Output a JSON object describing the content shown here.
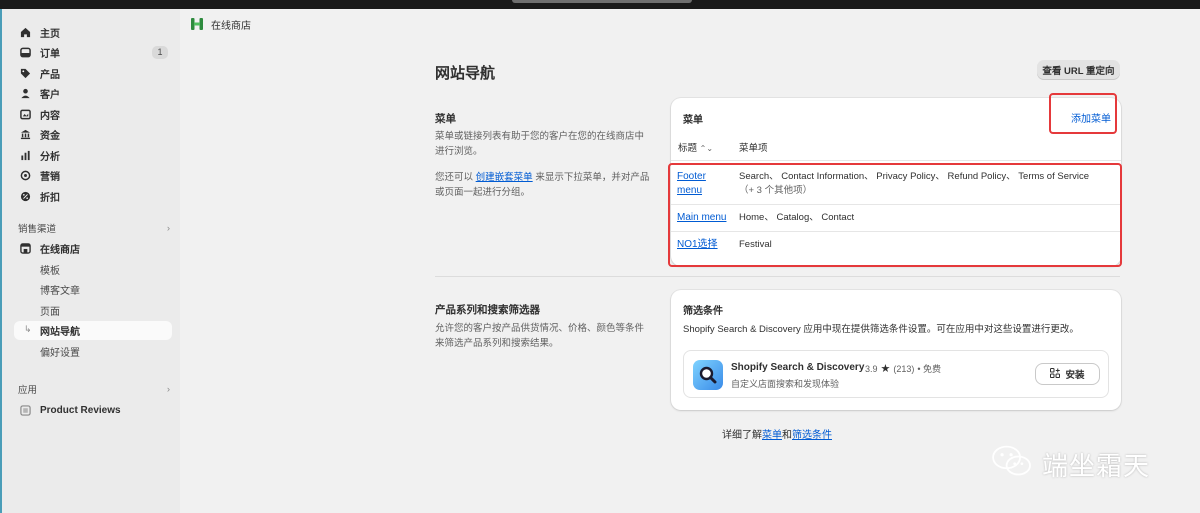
{
  "sidebar": {
    "nav": [
      {
        "label": "主页",
        "icon": "home-icon"
      },
      {
        "label": "订单",
        "icon": "inbox-icon",
        "badge": "1"
      },
      {
        "label": "产品",
        "icon": "tag-icon"
      },
      {
        "label": "客户",
        "icon": "person-icon"
      },
      {
        "label": "内容",
        "icon": "content-icon"
      },
      {
        "label": "资金",
        "icon": "bank-icon"
      },
      {
        "label": "分析",
        "icon": "bar-chart-icon"
      },
      {
        "label": "营销",
        "icon": "target-icon"
      },
      {
        "label": "折扣",
        "icon": "discount-icon"
      }
    ],
    "sales_channels_label": "销售渠道",
    "online_store_label": "在线商店",
    "sub_items": [
      "模板",
      "博客文章",
      "页面",
      "网站导航",
      "偏好设置"
    ],
    "apps_label": "应用",
    "app_item": "Product Reviews"
  },
  "breadcrumb": {
    "label": "在线商店"
  },
  "page": {
    "title": "网站导航",
    "redirect_button": "查看 URL 重定向"
  },
  "menus_section": {
    "title": "菜单",
    "desc": "菜单或链接列表有助于您的客户在您的在线商店中进行浏览。",
    "desc2_prefix": "您还可以",
    "desc2_link": "创建嵌套菜单",
    "desc2_suffix": "来显示下拉菜单，并对产品或页面一起进行分组。",
    "card_title": "菜单",
    "add_menu": "添加菜单",
    "col_title": "标题",
    "col_items": "菜单项",
    "rows": [
      {
        "title": "Footer menu",
        "items": "Search、 Contact Information、 Privacy Policy、 Refund Policy、 Terms of Service",
        "more": "（+ 3 个其他项）"
      },
      {
        "title": "Main menu",
        "items": "Home、 Catalog、 Contact",
        "more": ""
      },
      {
        "title": "NO1选择",
        "items": "Festival",
        "more": ""
      }
    ]
  },
  "filters_section": {
    "title": "产品系列和搜索筛选器",
    "desc": "允许您的客户按产品供货情况、价格、颜色等条件来筛选产品系列和搜索结果。",
    "card_title": "筛选条件",
    "card_desc": "Shopify Search & Discovery 应用中现在提供筛选条件设置。可在应用中对这些设置进行更改。",
    "app": {
      "name": "Shopify Search & Discovery",
      "rating": "3.9",
      "reviews": "(213)",
      "price": "• 免费",
      "subtitle": "自定义店面搜索和发现体验",
      "install": "安装"
    }
  },
  "footer": {
    "prefix": "详细了解",
    "link1": "菜单",
    "and": "和",
    "link2": "筛选条件"
  },
  "watermark": "端坐霜天",
  "colors": {
    "link": "#005bd3",
    "highlight": "#e5393b",
    "sidebar_bg": "#ebebeb",
    "topbar": "#1a1a1a"
  }
}
